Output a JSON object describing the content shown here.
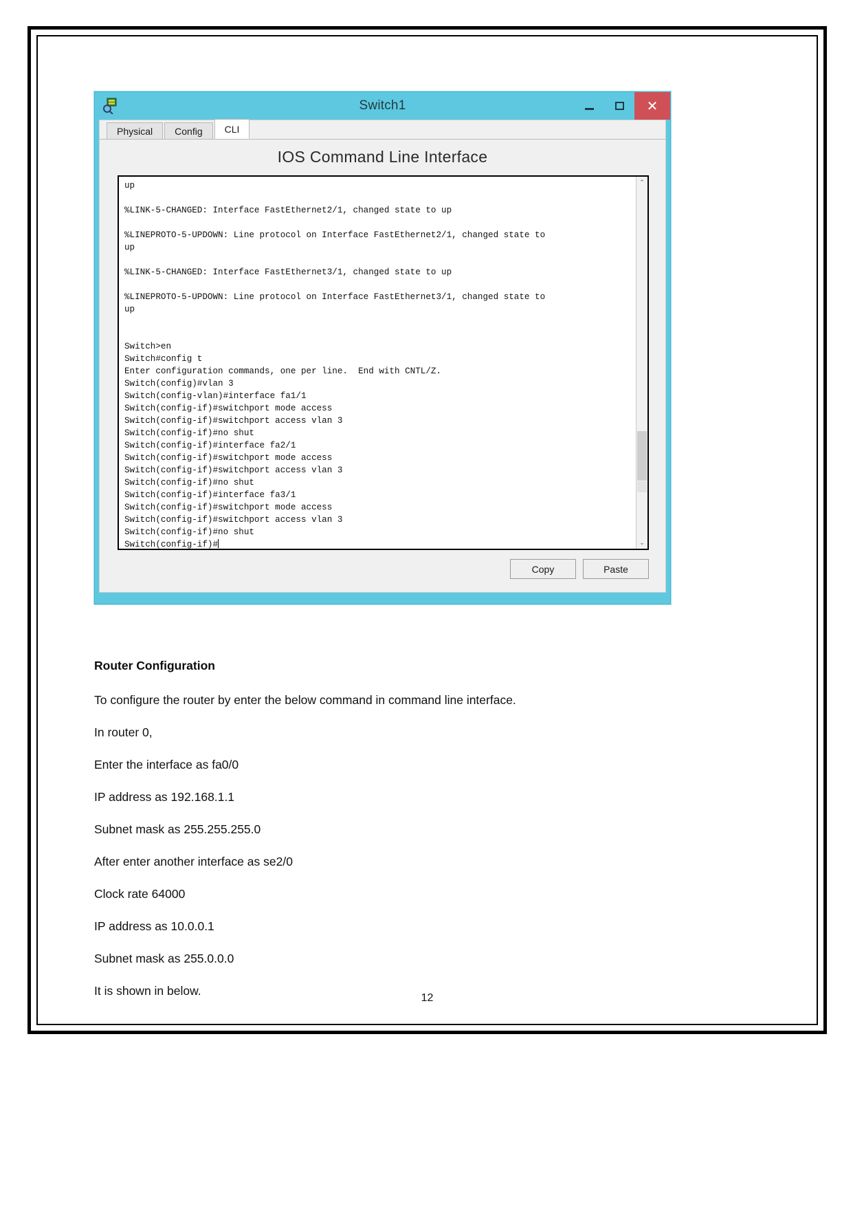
{
  "window": {
    "title": "Switch1",
    "icon": "packet-tracer-switch-icon",
    "controls": {
      "minimize": "–",
      "maximize": "□",
      "close": "✕"
    },
    "titlebar_color": "#5ec8e0",
    "close_color": "#cf5056",
    "tabs": [
      {
        "label": "Physical",
        "active": false
      },
      {
        "label": "Config",
        "active": false
      },
      {
        "label": "CLI",
        "active": true
      }
    ],
    "cli": {
      "heading": "IOS Command Line Interface",
      "lines": [
        "up",
        "",
        "%LINK-5-CHANGED: Interface FastEthernet2/1, changed state to up",
        "",
        "%LINEPROTO-5-UPDOWN: Line protocol on Interface FastEthernet2/1, changed state to",
        "up",
        "",
        "%LINK-5-CHANGED: Interface FastEthernet3/1, changed state to up",
        "",
        "%LINEPROTO-5-UPDOWN: Line protocol on Interface FastEthernet3/1, changed state to",
        "up",
        "",
        "",
        "Switch>en",
        "Switch#config t",
        "Enter configuration commands, one per line.  End with CNTL/Z.",
        "Switch(config)#vlan 3",
        "Switch(config-vlan)#interface fa1/1",
        "Switch(config-if)#switchport mode access",
        "Switch(config-if)#switchport access vlan 3",
        "Switch(config-if)#no shut",
        "Switch(config-if)#interface fa2/1",
        "Switch(config-if)#switchport mode access",
        "Switch(config-if)#switchport access vlan 3",
        "Switch(config-if)#no shut",
        "Switch(config-if)#interface fa3/1",
        "Switch(config-if)#switchport mode access",
        "Switch(config-if)#switchport access vlan 3",
        "Switch(config-if)#no shut"
      ],
      "prompt_line": "Switch(config-if)#",
      "scroll_up_arrow": "⌃",
      "scroll_down_arrow": "⌄",
      "copy_label": "Copy",
      "paste_label": "Paste"
    }
  },
  "document": {
    "heading": "Router Configuration",
    "lines": [
      "To configure the router by enter the below command in command line interface.",
      "In router 0,",
      "Enter the interface as fa0/0",
      "IP address as 192.168.1.1",
      "Subnet mask as 255.255.255.0",
      "After enter another interface as se2/0",
      "Clock rate 64000",
      "IP address as 10.0.0.1",
      "Subnet mask as 255.0.0.0",
      "It is shown in below."
    ],
    "page_number": "12"
  }
}
